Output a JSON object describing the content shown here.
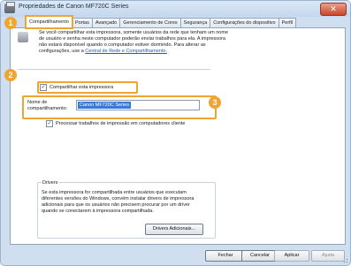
{
  "window": {
    "title": "Propriedades de Canon MF720C Series",
    "close_label": "✕"
  },
  "tabs": [
    {
      "label": "Compartilhamento"
    },
    {
      "label": "Portas"
    },
    {
      "label": "Avançado"
    },
    {
      "label": "Gerenciamento de Cores"
    },
    {
      "label": "Segurança"
    },
    {
      "label": "Configurações do dispositivo"
    },
    {
      "label": "Perfil"
    }
  ],
  "share": {
    "info_text": "Se você compartilhar esta impressora, somente usuários da rede que tenham um nome de usuário e senha neste computador poderão enviar trabalhos para ela. A impressora não estará disponível quando o computador estiver dormindo. Para alterar as configurações, use a",
    "info_link": "Central de Rede e Compartilhamento.",
    "share_label": "Compartilhar esta impressora",
    "share_checked": true,
    "name_label": "Nome de compartilhamento:",
    "name_value": "Canon MF720C Series",
    "render_label": "Processar trabalhos de impressão em computadores cliente",
    "render_checked": true
  },
  "drivers": {
    "title": "Drivers",
    "text": "Se esta impressora for compartilhada entre usuários que executam diferentes versões do Windows, convém instalar drivers de impressora adicionais para que os usuários não precisem procurar por um driver quando se conectarem à impressora compartilhada.",
    "button_label": "Drivers Adicionais..."
  },
  "buttons": {
    "close": "Fechar",
    "cancel": "Cancelar",
    "apply": "Aplicar",
    "help": "Ajuda"
  },
  "badges": {
    "one": "1",
    "two": "2",
    "three": "3"
  },
  "colors": {
    "highlight": "#f0a431",
    "selection": "#3c79d4",
    "link": "#1b5fb5"
  }
}
